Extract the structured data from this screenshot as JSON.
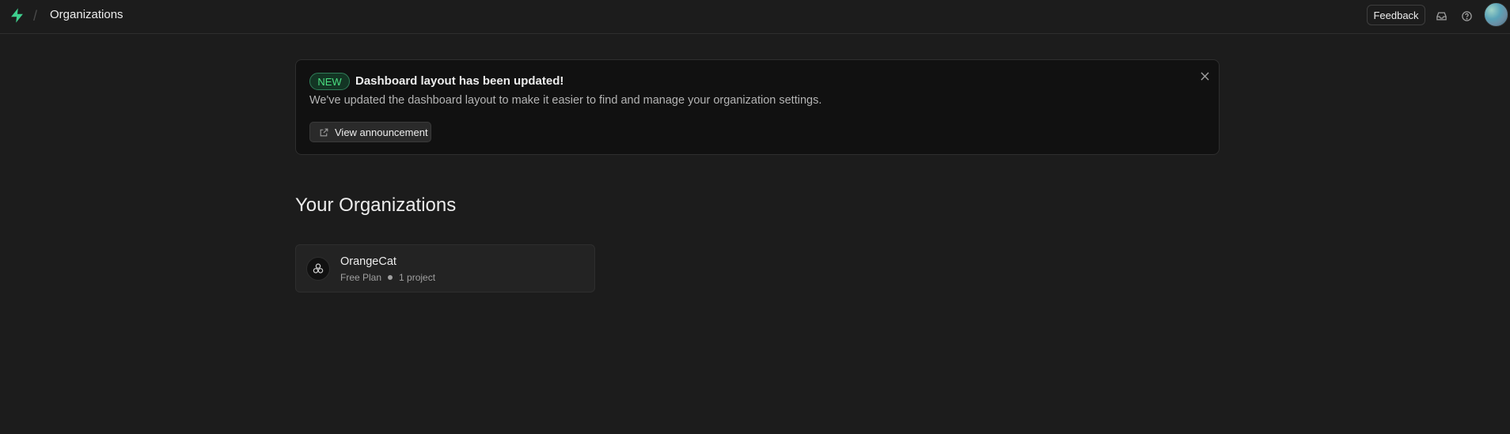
{
  "header": {
    "breadcrumb_separator": "/",
    "title": "Organizations",
    "feedback_label": "Feedback",
    "icons": [
      "supabase-logo-icon",
      "inbox-icon",
      "help-icon",
      "avatar"
    ]
  },
  "announcement": {
    "badge": "NEW",
    "title": "Dashboard layout has been updated!",
    "description": "We've updated the dashboard layout to make it easier to find and manage your organization settings.",
    "button_label": "View announcement"
  },
  "organizations_section": {
    "title": "Your Organizations",
    "items": [
      {
        "name": "OrangeCat",
        "plan": "Free Plan",
        "projects": "1 project"
      }
    ]
  },
  "colors": {
    "background": "#1c1c1c",
    "brand": "#3ecf8e",
    "badge_text": "#4ade80"
  }
}
